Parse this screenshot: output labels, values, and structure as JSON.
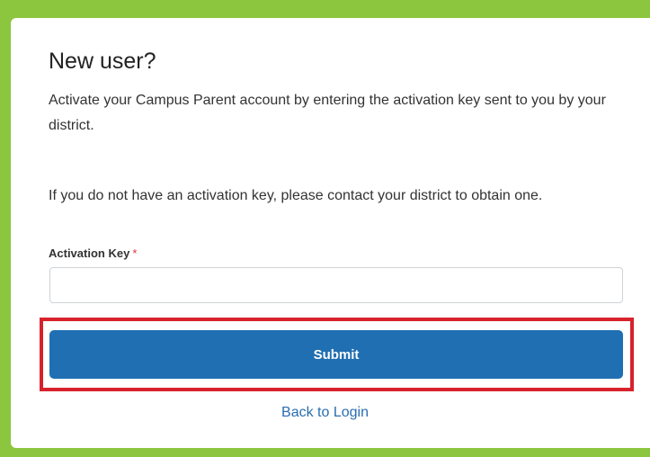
{
  "form": {
    "title": "New user?",
    "intro": "Activate your Campus Parent account by entering the activation key sent to you by your district.",
    "help": "If you do not have an activation key, please contact your district to obtain one.",
    "activation_key_label": "Activation Key",
    "required_marker": "*",
    "activation_key_value": "",
    "activation_key_placeholder": "",
    "submit_label": "Submit",
    "back_link": "Back to Login"
  },
  "colors": {
    "page_background": "#8cc63f",
    "card_background": "#ffffff",
    "submit_button": "#1f6fb2",
    "highlight_border": "#d7222c",
    "link": "#2a6db0",
    "required": "#d9363e"
  }
}
